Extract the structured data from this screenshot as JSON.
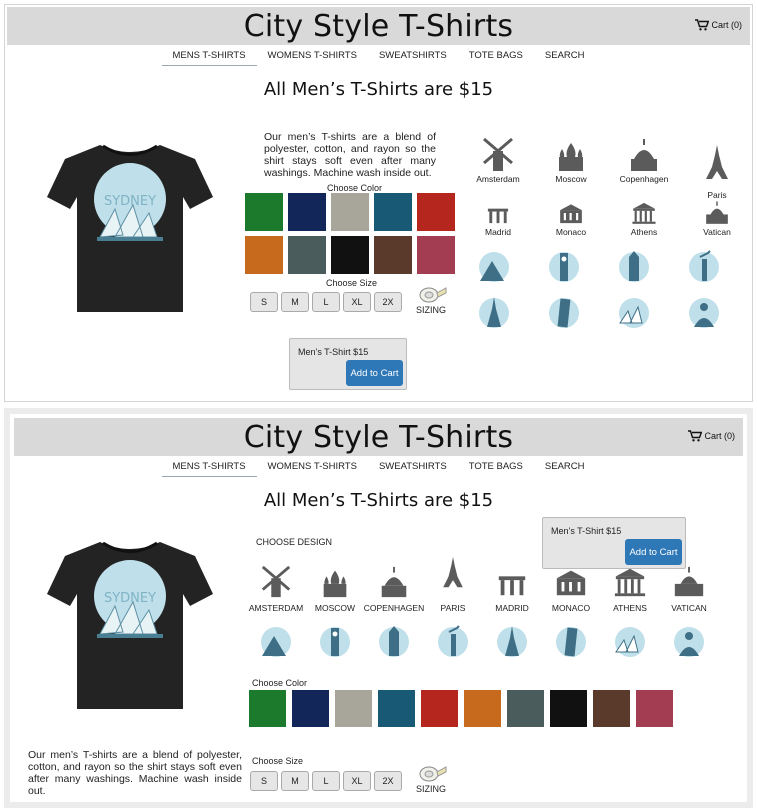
{
  "site_title": "City Style T-Shirts",
  "cart_label": "Cart (0)",
  "nav": [
    "MENS T-SHIRTS",
    "WOMENS T-SHIRTS",
    "SWEATSHIRTS",
    "TOTE BAGS",
    "SEARCH"
  ],
  "heading": "All Men’s T-Shirts are $15",
  "description": "Our men’s T-shirts are a blend of polyester, cotton, and rayon so the shirt stays soft even after many washings. Machine wash inside out.",
  "choose_color_label": "Choose Color",
  "choose_size_label": "Choose Size",
  "choose_design_label": "CHOOSE DESIGN",
  "sizes": [
    "S",
    "M",
    "L",
    "XL",
    "2X"
  ],
  "sizing_label": "SIZING",
  "cart_item": "Men’s T-Shirt $15",
  "add_to_cart": "Add to Cart",
  "shirt_print": "SYDNEY",
  "colors": [
    "#1c7a2c",
    "#13265a",
    "#a8a69b",
    "#185a76",
    "#b5261e",
    "#c86a1e",
    "#4a5d5c",
    "#111111",
    "#5a3a2a",
    "#a33e52"
  ],
  "landmarks_top": [
    "Amsterdam",
    "Moscow",
    "Copenhagen",
    "Paris",
    "Madrid",
    "Monaco",
    "Athens",
    "Vatican"
  ],
  "landmarks_bottom": [
    "AMSTERDAM",
    "MOSCOW",
    "COPENHAGEN",
    "PARIS",
    "MADRID",
    "MONACO",
    "ATHENS",
    "VATICAN"
  ],
  "design_icons": [
    "mountain",
    "big-ben",
    "clock-tower",
    "statue-of-liberty",
    "eiffel-tower",
    "leaning-tower",
    "sydney-opera-house",
    "buddha"
  ]
}
